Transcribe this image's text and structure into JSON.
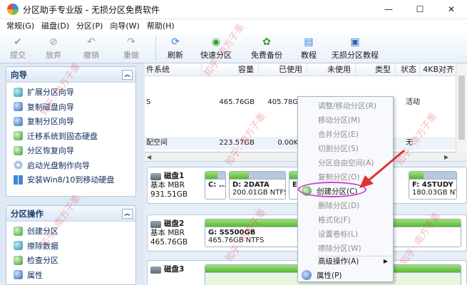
{
  "window": {
    "title": "分区助手专业版 - 无损分区免费软件",
    "minimize_glyph": "—",
    "maximize_glyph": "☐",
    "close_glyph": "✕"
  },
  "menu": [
    "常规(G)",
    "磁盘(D)",
    "分区(P)",
    "向导(W)",
    "帮助(H)"
  ],
  "toolbar": {
    "commit": "提交",
    "discard": "放弃",
    "undo": "撤销",
    "redo": "重做",
    "refresh": "刷新",
    "quick_partition": "快速分区",
    "free_backup": "免费备份",
    "tutorial": "教程",
    "lossless_tutorial": "无损分区教程"
  },
  "wizard_panel": {
    "title": "向导",
    "items": [
      "扩展分区向导",
      "复制磁盘向导",
      "复制分区向导",
      "迁移系统到固态硬盘",
      "分区恢复向导",
      "启动光盘制作向导",
      "安装Win8/10到移动硬盘"
    ]
  },
  "ops_panel": {
    "title": "分区操作",
    "items": [
      "创建分区",
      "擦除数据",
      "检查分区",
      "属性"
    ]
  },
  "list": {
    "headers": [
      "件系统",
      "容量",
      "已使用",
      "未使用",
      "类型",
      "状态",
      "4KB对齐"
    ],
    "rows": [
      {
        "fs": "S",
        "capacity": "465.76GB",
        "used": "405.78GB",
        "free": "",
        "type": "",
        "status": "活动",
        "align": ""
      },
      {
        "fs": "配空间",
        "capacity": "223.57GB",
        "used": "0.00KB",
        "free": "",
        "type": "",
        "status": "无",
        "align": ""
      }
    ]
  },
  "disks": [
    {
      "name": "磁盘1",
      "type": "基本 MBR",
      "size": "931.51GB",
      "partitions": [
        {
          "name": "C: ...",
          "size": "",
          "fill": 0.6
        },
        {
          "name": "D: 2DATA",
          "size": "200.01GB NTFS",
          "fill": 0.35
        },
        {
          "name": "E: ...",
          "size": "",
          "fill": 0.5
        },
        {
          "name": "F: 4STUDY",
          "size": "180.03GB NTFS",
          "fill": 0.3
        }
      ]
    },
    {
      "name": "磁盘2",
      "type": "基本 MBR",
      "size": "465.76GB",
      "partitions": [
        {
          "name": "G: SS500GB",
          "size": "465.76GB NTFS",
          "fill": 1.0
        }
      ]
    },
    {
      "name": "磁盘3",
      "type": "",
      "size": "",
      "partitions": []
    }
  ],
  "context_menu": {
    "items": [
      "调整/移动分区(R)",
      "移动分区(M)",
      "合并分区(E)",
      "切割分区(S)",
      "分区自由空间(A)",
      "复制分区(O)",
      "创建分区(C)",
      "删除分区(D)",
      "格式化(F)",
      "设置卷标(L)",
      "擦除分区(W)",
      "高级操作(A)",
      "属性(P)"
    ]
  },
  "watermark": "知乎: 南方子墨",
  "colors": {
    "accent": "#1e3d6e",
    "highlight_ellipse": "#d63bd0",
    "arrow": "#e03030",
    "used_fill": "#58b832"
  }
}
